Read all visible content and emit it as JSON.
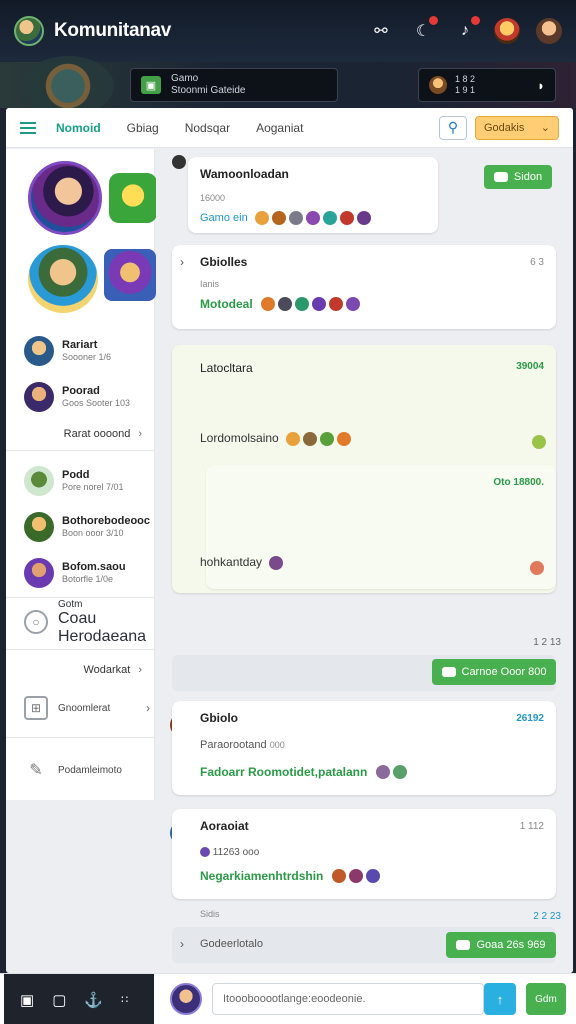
{
  "header": {
    "title": "Komunitanav",
    "strip_card": {
      "line1": "Gamo",
      "line2": "Stoonmi Gateide"
    },
    "strip_card2": {
      "line1": "1 8 2",
      "line2": "1 9 1"
    }
  },
  "tabs": {
    "items": [
      "Nomoid",
      "Gbiag",
      "Nodsqar",
      "Aoganiat"
    ],
    "dropdown": "Godakis"
  },
  "sidebar": {
    "friends_top": [
      {
        "name": "Rariart",
        "sub": "Soooner 1/6"
      },
      {
        "name": "Poorad",
        "sub": "Goos Sooter 103"
      }
    ],
    "link1": "Rarat oooond",
    "friends_mid": [
      {
        "name": "Podd",
        "sub": "Pore norel 7/01"
      },
      {
        "name": "Bothorebodeooc",
        "sub": "Boon ooor 3/10"
      },
      {
        "name": "Bofom.saou",
        "sub": "Botorfle 1/0e"
      }
    ],
    "item_card": {
      "name": "Gotm",
      "sub": "Coau Herodaeana"
    },
    "link2": "Wodarkat",
    "item_grid": "Gnoomlerat",
    "item_edit": "Podamleimoto"
  },
  "feed": {
    "post1": {
      "title": "Wamoonloadan",
      "sub": "16000",
      "text": "Gamo ein",
      "button": "Sidon"
    },
    "post2": {
      "title": "Gbiolles",
      "sub": "Ianis",
      "text": "Motodeal",
      "meta": "6 3"
    },
    "post3": {
      "title": "Latocltara",
      "text": "Lordomolsaino",
      "meta": "39004",
      "inner_meta": "Oto 18800.",
      "inner_text": "hohkantday"
    },
    "timestamp": "1 2 13",
    "action_btn": "Carnoe Ooor 800",
    "post4": {
      "title": "Gbiolo",
      "sub": "Paraorootand",
      "sub2": "000",
      "text": "Fadoarr Roomotidet,patalann",
      "meta": "26192"
    },
    "post5": {
      "title": "Aoraoiat",
      "sub": "11263 ooo",
      "text": "Negarkiamenhtrdshin",
      "meta": "1 112"
    },
    "post6": {
      "sub": "Sidis",
      "text": "Godeerlotalo",
      "meta": "2 2 23",
      "btn": "Goaa 26s 969"
    }
  },
  "composer": {
    "placeholder": "Itooobooootlange:eoodeonie.",
    "go": "Gdm"
  }
}
